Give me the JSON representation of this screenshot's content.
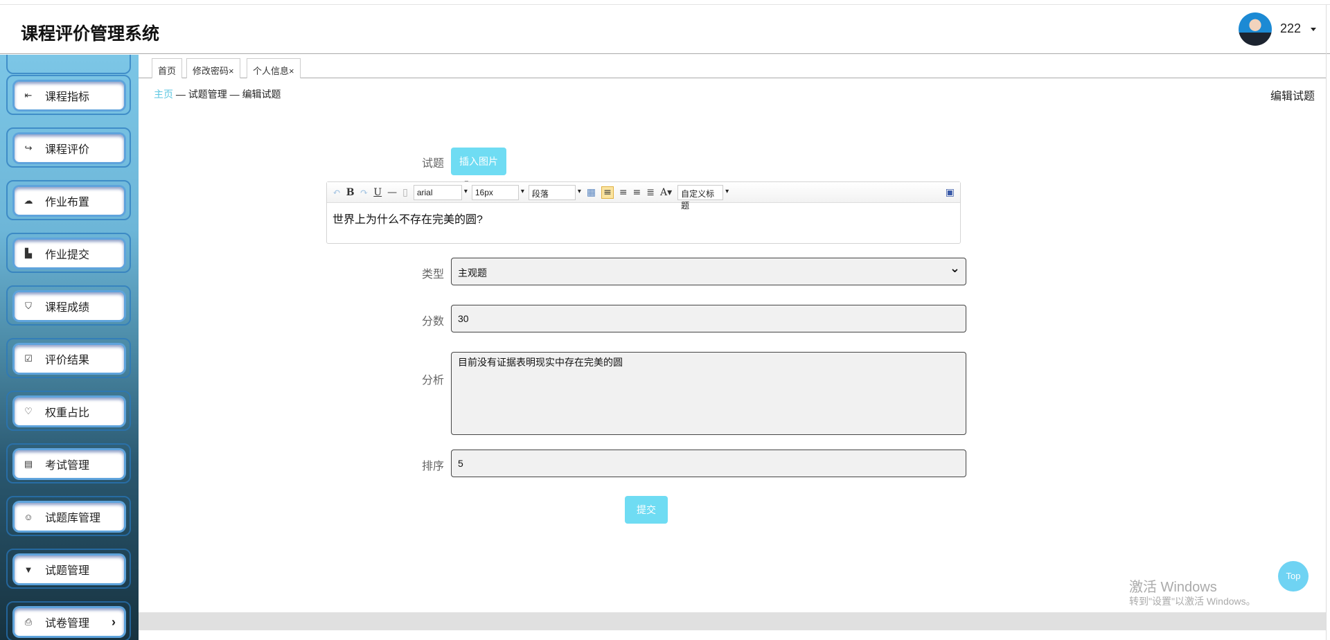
{
  "header": {
    "title": "课程评价管理系统",
    "username": "222"
  },
  "sidebar": {
    "items": [
      {
        "label": "课程指标",
        "icon": "⇤"
      },
      {
        "label": "课程评价",
        "icon": "↪"
      },
      {
        "label": "作业布置",
        "icon": "☁"
      },
      {
        "label": "作业提交",
        "icon": "▙"
      },
      {
        "label": "课程成绩",
        "icon": "⛉"
      },
      {
        "label": "评价结果",
        "icon": "☑"
      },
      {
        "label": "权重占比",
        "icon": "♡"
      },
      {
        "label": "考试管理",
        "icon": "▤"
      },
      {
        "label": "试题库管理",
        "icon": "☺"
      },
      {
        "label": "试题管理",
        "icon": "▼"
      },
      {
        "label": "试卷管理",
        "icon": "⎙",
        "chevron": "›"
      }
    ]
  },
  "tabs": [
    {
      "label": "首页"
    },
    {
      "label": "修改密码×"
    },
    {
      "label": "个人信息×"
    }
  ],
  "breadcrumb": {
    "home": "主页",
    "sep": " — ",
    "section": "试题管理",
    "current": "编辑试题"
  },
  "page_title": "编辑试题",
  "form": {
    "question_label": "试题",
    "insert_image": "插入图片",
    "editor": {
      "font": "arial",
      "size": "16px",
      "paragraph": "段落",
      "custom_title": "自定义标题",
      "content": "世界上为什么不存在完美的圆?"
    },
    "type_label": "类型",
    "type_value": "主观题",
    "score_label": "分数",
    "score_value": "30",
    "analysis_label": "分析",
    "analysis_value": "目前没有证据表明现实中存在完美的圆",
    "order_label": "排序",
    "order_value": "5",
    "submit": "提交"
  },
  "top_button": "Top",
  "watermark": {
    "line1": "激活 Windows",
    "line2": "转到\"设置\"以激活 Windows。"
  }
}
